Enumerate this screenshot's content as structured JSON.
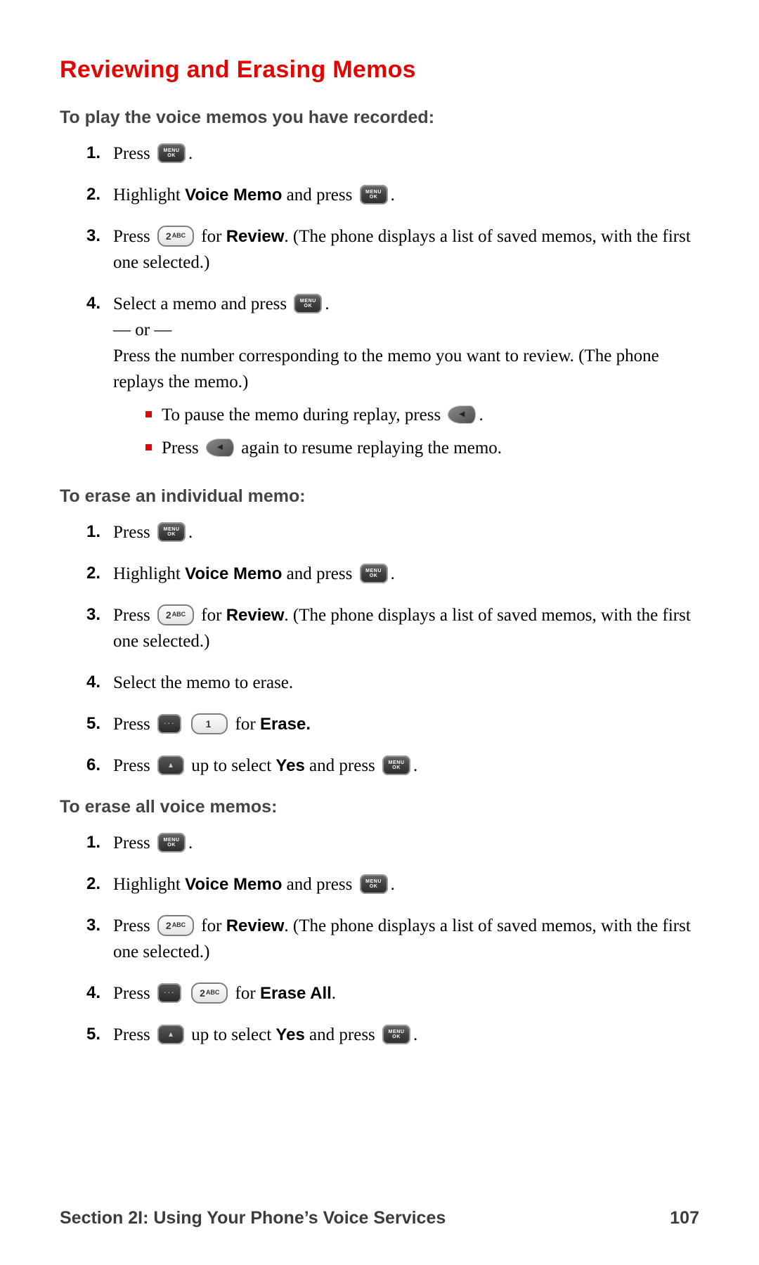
{
  "title": "Reviewing and Erasing Memos",
  "icons": {
    "menu_line1": "MENU",
    "menu_line2": "OK",
    "two_abc": "2",
    "two_abc_sub": "ABC",
    "one": "1",
    "back_arrow": "◂",
    "dots": "···",
    "nav_up": "▴"
  },
  "sec1": {
    "head": "To play the voice memos you have recorded:",
    "s1_a": "Press ",
    "s1_b": ".",
    "s2_a": "Highlight ",
    "s2_bold": "Voice Memo",
    "s2_b": " and press ",
    "s2_c": ".",
    "s3_a": "Press ",
    "s3_b": " for ",
    "s3_bold": "Review",
    "s3_c": ". (The phone displays a list of saved memos, with the first one selected.)",
    "s4_a": "Select a memo and press ",
    "s4_b": ".",
    "s4_or": "— or —",
    "s4_c": "Press the number corresponding to the memo you want to review. (The phone replays the memo.)",
    "s4_sub1_a": "To pause the memo during replay, press ",
    "s4_sub1_b": ".",
    "s4_sub2_a": "Press ",
    "s4_sub2_b": " again to resume replaying the memo."
  },
  "sec2": {
    "head": "To erase an individual memo:",
    "s1_a": "Press ",
    "s1_b": ".",
    "s2_a": "Highlight ",
    "s2_bold": "Voice Memo",
    "s2_b": " and press ",
    "s2_c": ".",
    "s3_a": "Press ",
    "s3_b": " for ",
    "s3_bold": "Review",
    "s3_c": ". (The phone displays a list of saved memos, with the first one selected.)",
    "s4": "Select the memo to erase.",
    "s5_a": "Press ",
    "s5_b": " ",
    "s5_c": " for ",
    "s5_bold": "Erase.",
    "s6_a": "Press ",
    "s6_b": " up to select ",
    "s6_bold": "Yes",
    "s6_c": " and press ",
    "s6_d": "."
  },
  "sec3": {
    "head": "To erase all voice memos:",
    "s1_a": "Press ",
    "s1_b": ".",
    "s2_a": "Highlight ",
    "s2_bold": "Voice Memo",
    "s2_b": " and press ",
    "s2_c": ".",
    "s3_a": "Press ",
    "s3_b": " for ",
    "s3_bold": "Review",
    "s3_c": ". (The phone displays a list of saved memos, with the first one selected.)",
    "s4_a": "Press ",
    "s4_b": " ",
    "s4_c": " for ",
    "s4_bold": "Erase All",
    "s4_d": ".",
    "s5_a": "Press ",
    "s5_b": " up to select ",
    "s5_bold": "Yes",
    "s5_c": " and press ",
    "s5_d": "."
  },
  "footer": {
    "left": "Section 2I: Using Your Phone’s Voice Services",
    "right": "107"
  }
}
